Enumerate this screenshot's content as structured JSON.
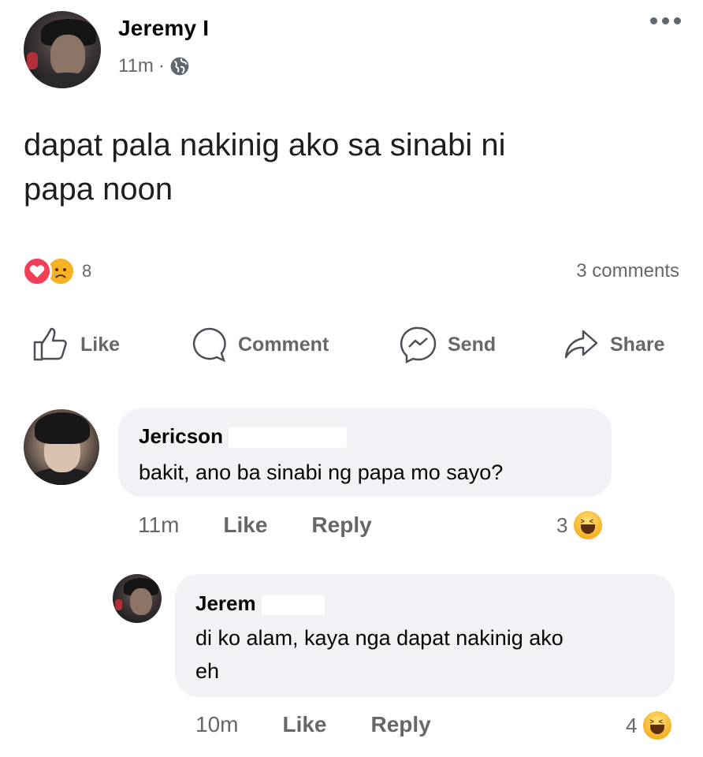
{
  "post": {
    "author": "Jeremy I",
    "time": "11m",
    "separator": "·",
    "privacy_icon": "globe-icon",
    "text_line1": "dapat pala nakinig ako sa sinabi ni",
    "text_line2": "papa noon",
    "reaction_count": "8",
    "comments_count": "3 comments"
  },
  "actions": {
    "like": "Like",
    "comment": "Comment",
    "send": "Send",
    "share": "Share"
  },
  "comments": [
    {
      "author": "Jericson",
      "text": "bakit, ano ba sinabi ng papa mo sayo?",
      "time": "11m",
      "like": "Like",
      "reply": "Reply",
      "reaction_count": "3"
    },
    {
      "author": "Jerem",
      "text_line1": "di ko alam, kaya nga dapat nakinig ako",
      "text_line2": "eh",
      "time": "10m",
      "like": "Like",
      "reply": "Reply",
      "reaction_count": "4"
    }
  ],
  "colors": {
    "bubble": "#f0f2f5",
    "secondary_text": "#65676b",
    "love": "#f33e58",
    "sad": "#f7b125"
  }
}
